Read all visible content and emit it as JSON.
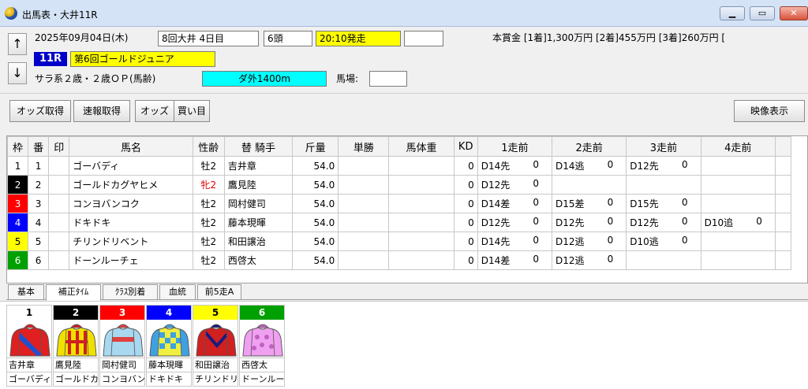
{
  "window": {
    "title": "出馬表・大井11R",
    "minimize": "▁",
    "maximize": "▭",
    "close": "✕"
  },
  "header": {
    "nav_up": "↑",
    "nav_down": "↓",
    "date": "2025年09月04日(木)",
    "meeting": "8回大井 4日目",
    "heads": "6頭",
    "post_time": "20:10発走",
    "prize": "本賞金 [1着]1,300万円 [2着]455万円 [3着]260万円 [",
    "race_no": "11R",
    "race_name": "第6回ゴールドジュニア",
    "race_class": "サラ系２歳・２歳ＯＰ(馬齢)",
    "course": "ダ外1400m",
    "baba_label": "馬場:"
  },
  "toolbar": {
    "odds_get": "オッズ取得",
    "flash_get": "速報取得",
    "odds": "オッズ",
    "buy": "買い目",
    "video": "映像表示"
  },
  "grid": {
    "headers": [
      "枠",
      "番",
      "印",
      "馬名",
      "性齢",
      "替 騎手",
      "斤量",
      "単勝",
      "馬体重",
      "KD",
      "1走前",
      "2走前",
      "3走前",
      "4走前"
    ],
    "rows": [
      {
        "waku": "1",
        "ban": "1",
        "mark": "",
        "horse": "ゴーバディ",
        "sex_age": "牡2",
        "jockey": "吉井章",
        "weight": "54.0",
        "odds": "",
        "body": "",
        "kd": "0",
        "r1": "D14先",
        "r1p": "0",
        "r2": "D14逃",
        "r2p": "0",
        "r3": "D12先",
        "r3p": "0",
        "r4": "",
        "r4p": ""
      },
      {
        "waku": "2",
        "ban": "2",
        "mark": "",
        "horse": "ゴールドカグヤヒメ",
        "sex_age": "牝2",
        "jockey": "鷹見陸",
        "weight": "54.0",
        "odds": "",
        "body": "",
        "kd": "0",
        "r1": "D12先",
        "r1p": "0",
        "r2": "",
        "r2p": "",
        "r3": "",
        "r3p": "",
        "r4": "",
        "r4p": ""
      },
      {
        "waku": "3",
        "ban": "3",
        "mark": "",
        "horse": "コンヨバンコク",
        "sex_age": "牡2",
        "jockey": "岡村健司",
        "weight": "54.0",
        "odds": "",
        "body": "",
        "kd": "0",
        "r1": "D14差",
        "r1p": "0",
        "r2": "D15差",
        "r2p": "0",
        "r3": "D15先",
        "r3p": "0",
        "r4": "",
        "r4p": ""
      },
      {
        "waku": "4",
        "ban": "4",
        "mark": "",
        "horse": "ドキドキ",
        "sex_age": "牡2",
        "jockey": "藤本現暉",
        "weight": "54.0",
        "odds": "",
        "body": "",
        "kd": "0",
        "r1": "D12先",
        "r1p": "0",
        "r2": "D12先",
        "r2p": "0",
        "r3": "D12先",
        "r3p": "0",
        "r4": "D10追",
        "r4p": "0"
      },
      {
        "waku": "5",
        "ban": "5",
        "mark": "",
        "horse": "チリンドリベント",
        "sex_age": "牡2",
        "jockey": "和田譲治",
        "weight": "54.0",
        "odds": "",
        "body": "",
        "kd": "0",
        "r1": "D14先",
        "r1p": "0",
        "r2": "D12逃",
        "r2p": "0",
        "r3": "D10逃",
        "r3p": "0",
        "r4": "",
        "r4p": ""
      },
      {
        "waku": "6",
        "ban": "6",
        "mark": "",
        "horse": "ドーンルーチェ",
        "sex_age": "牡2",
        "jockey": "西啓太",
        "weight": "54.0",
        "odds": "",
        "body": "",
        "kd": "0",
        "r1": "D14差",
        "r1p": "0",
        "r2": "D12逃",
        "r2p": "0",
        "r3": "",
        "r3p": "",
        "r4": "",
        "r4p": ""
      }
    ]
  },
  "waku_colors": {
    "1": {
      "bg": "#ffffff",
      "fg": "#000000"
    },
    "2": {
      "bg": "#000000",
      "fg": "#ffffff"
    },
    "3": {
      "bg": "#ff0000",
      "fg": "#ffffff"
    },
    "4": {
      "bg": "#0000ff",
      "fg": "#ffffff"
    },
    "5": {
      "bg": "#ffff00",
      "fg": "#000000"
    },
    "6": {
      "bg": "#00a000",
      "fg": "#ffffff"
    }
  },
  "bottom_tabs": [
    "基本",
    "補正ﾀｲﾑ",
    "ｸﾗｽ別着",
    "血統",
    "前5走A"
  ],
  "silks": [
    {
      "num": "1",
      "jockey": "吉井章",
      "horse": "ゴーバディ",
      "body": "#e02020",
      "sash": "#2050d0",
      "sleeve": "#e02020",
      "cap": "#e02020",
      "pattern": "sash"
    },
    {
      "num": "2",
      "jockey": "鷹見陸",
      "horse": "ゴールドカグヤヒメ",
      "body": "#f0e000",
      "sash": "#d02020",
      "sleeve": "#f0e000",
      "cap": "#d02020",
      "pattern": "cross"
    },
    {
      "num": "3",
      "jockey": "岡村健司",
      "horse": "コンヨバンコク",
      "body": "#a8d8f0",
      "sash": "#e04040",
      "sleeve": "#a8d8f0",
      "cap": "#e04040",
      "pattern": "band"
    },
    {
      "num": "4",
      "jockey": "藤本現暉",
      "horse": "ドキドキ",
      "body": "#f0f040",
      "sash": "#40a0e0",
      "sleeve": "#40a0e0",
      "cap": "#40a0e0",
      "pattern": "check"
    },
    {
      "num": "5",
      "jockey": "和田譲治",
      "horse": "チリンドリベント",
      "body": "#d02020",
      "sash": "#1a1a80",
      "sleeve": "#d02020",
      "cap": "#1a1a80",
      "pattern": "vee"
    },
    {
      "num": "6",
      "jockey": "西啓太",
      "horse": "ドーンルーチェ",
      "body": "#f0a0f0",
      "sash": "#c060c0",
      "sleeve": "#f0a0f0",
      "cap": "#c060c0",
      "pattern": "dots"
    }
  ]
}
